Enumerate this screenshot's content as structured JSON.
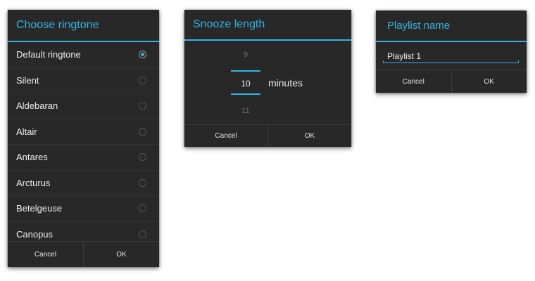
{
  "ringtone_dialog": {
    "title": "Choose ringtone",
    "items": [
      {
        "label": "Default ringtone",
        "selected": true
      },
      {
        "label": "Silent",
        "selected": false
      },
      {
        "label": "Aldebaran",
        "selected": false
      },
      {
        "label": "Altair",
        "selected": false
      },
      {
        "label": "Antares",
        "selected": false
      },
      {
        "label": "Arcturus",
        "selected": false
      },
      {
        "label": "Betelgeuse",
        "selected": false
      },
      {
        "label": "Canopus",
        "selected": false
      }
    ],
    "cancel_label": "Cancel",
    "ok_label": "OK"
  },
  "snooze_dialog": {
    "title": "Snooze length",
    "prev_value": "9",
    "current_value": "10",
    "next_value": "11",
    "unit": "minutes",
    "cancel_label": "Cancel",
    "ok_label": "OK"
  },
  "playlist_dialog": {
    "title": "Playlist name",
    "input_value": "Playlist 1",
    "cancel_label": "Cancel",
    "ok_label": "OK"
  },
  "colors": {
    "accent": "#33b5e5",
    "dialog_bg": "#282828",
    "text": "#eeeeee",
    "faded_text": "#6e6e6e"
  }
}
